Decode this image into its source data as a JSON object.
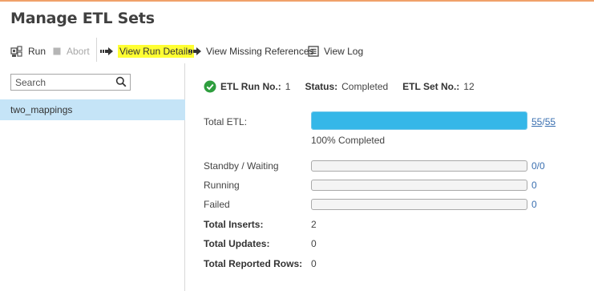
{
  "page": {
    "title": "Manage ETL Sets"
  },
  "toolbar": {
    "run_label": "Run",
    "abort_label": "Abort",
    "view_run_details_label": "View Run Details",
    "view_missing_references_label": "View Missing References",
    "view_log_label": "View Log"
  },
  "sidebar": {
    "search_placeholder": "Search",
    "items": [
      {
        "label": "two_mappings"
      }
    ]
  },
  "summary": {
    "etl_run_no_label": "ETL Run No.:",
    "etl_run_no": "1",
    "status_label": "Status:",
    "status": "Completed",
    "etl_set_no_label": "ETL Set No.:",
    "etl_set_no": "12"
  },
  "progress": {
    "total_etl_label": "Total ETL:",
    "done": "55",
    "separator": "/",
    "total": "55",
    "fraction": 1.0,
    "completed_text": "100% Completed"
  },
  "queues": [
    {
      "label": "Standby / Waiting",
      "value": "0/0",
      "fraction": 0
    },
    {
      "label": "Running",
      "value": "0",
      "fraction": 0
    },
    {
      "label": "Failed",
      "value": "0",
      "fraction": 0
    }
  ],
  "totals": [
    {
      "label": "Total Inserts:",
      "value": "2"
    },
    {
      "label": "Total Updates:",
      "value": "0"
    },
    {
      "label": "Total Reported Rows:",
      "value": "0"
    }
  ],
  "colors": {
    "accent": "#35b7e8",
    "success": "#2e9e3e",
    "link": "#3a6fb0",
    "selected_row": "#c5e4f7",
    "highlight": "#ffff33"
  }
}
